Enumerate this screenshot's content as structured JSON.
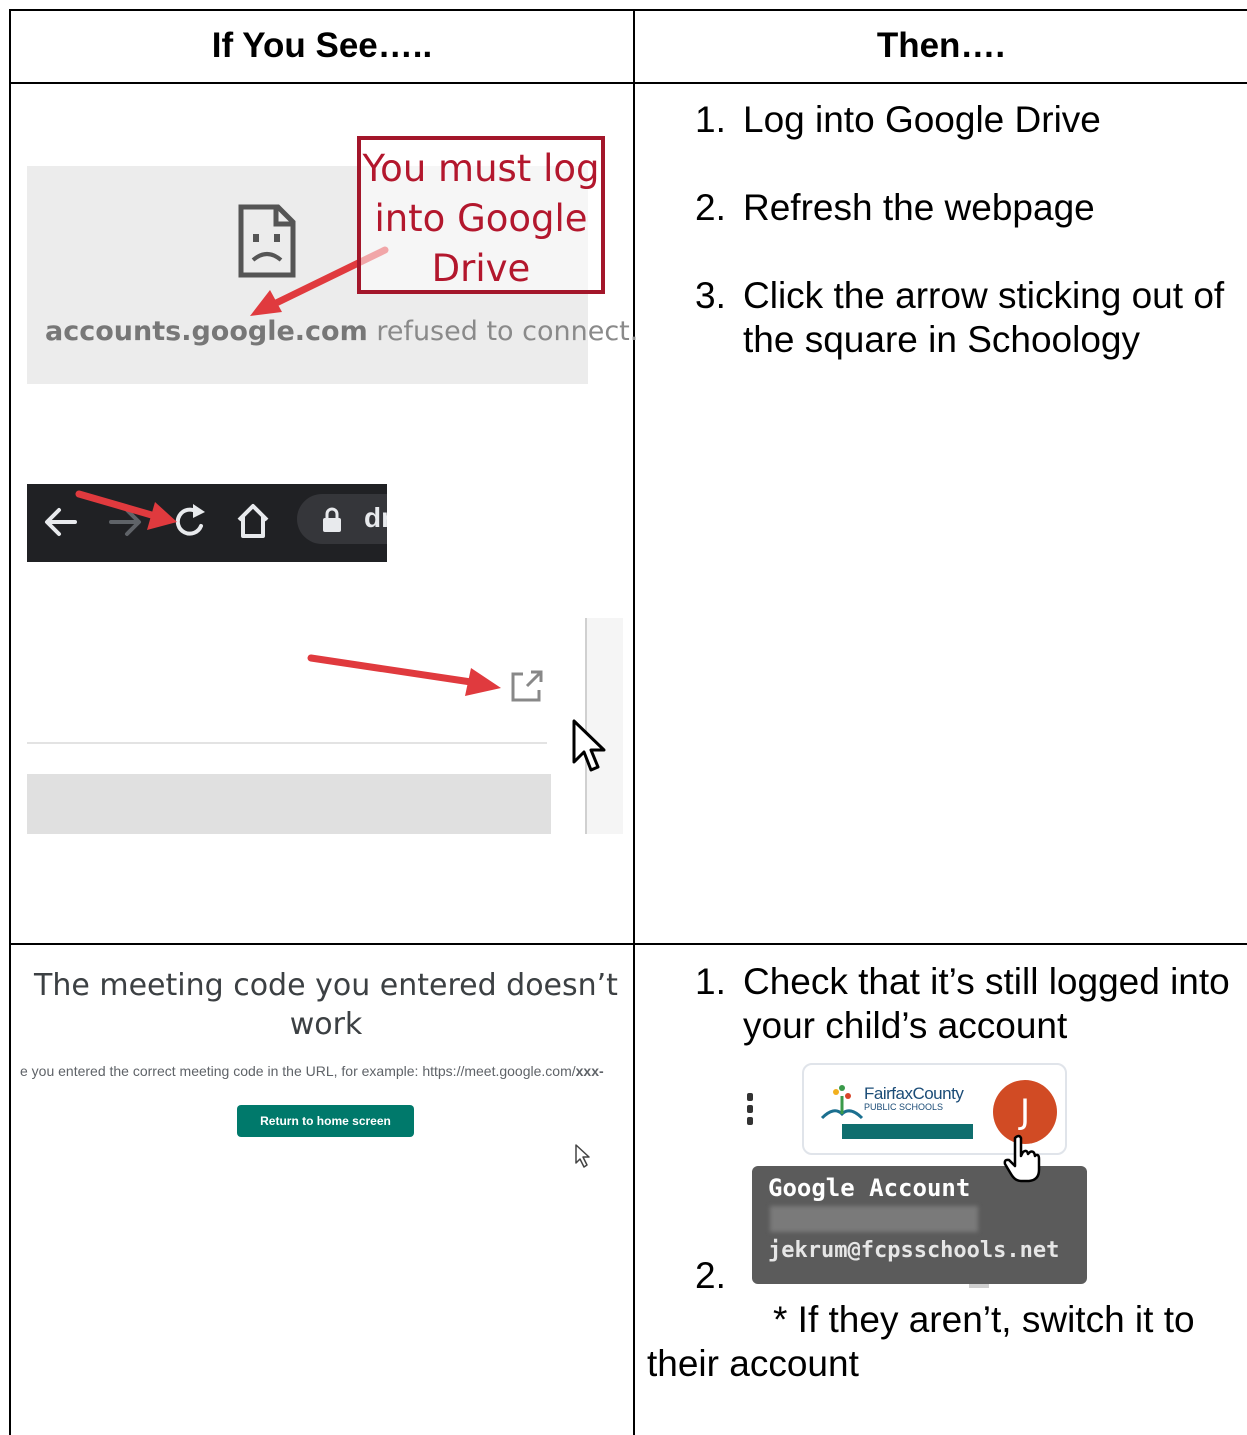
{
  "table": {
    "header_left": "If You See…..",
    "header_right": "Then…."
  },
  "row1": {
    "steps": [
      {
        "num": "1.",
        "text": "Log into Google Drive"
      },
      {
        "num": "2.",
        "text": "Refresh the webpage"
      },
      {
        "num": "3.",
        "text": "Click the arrow sticking out of the square in Schoology"
      }
    ],
    "refused": {
      "domain": "accounts.google.com",
      "rest": " refused to connect.",
      "callout": "You must log into Google Drive"
    },
    "toolbar": {
      "url_fragment": "dr"
    }
  },
  "row2": {
    "steps": [
      {
        "num": "1.",
        "text": "Check that it’s still logged into your child’s account"
      }
    ],
    "step2_num": "2.",
    "note": "* If they aren’t, switch it to their account",
    "meet": {
      "title": "The meeting code you entered doesn’t work",
      "subtitle_prefix": "e you entered the correct meeting code in the URL, for example: https://meet.google.com/",
      "subtitle_code": "xxx-",
      "button": "Return to home screen"
    },
    "account": {
      "logo_name": "FairfaxCounty",
      "logo_sub": "PUBLIC SCHOOLS",
      "avatar_letter": "J",
      "tooltip_title": "Google Account",
      "tooltip_email": "jekrum@fcpsschools.net"
    }
  },
  "colors": {
    "callout_red": "#a3162a",
    "arrow_red": "#e03a3e",
    "meet_button": "#00796b",
    "avatar": "#d14b24",
    "toolbar_bg": "#202124"
  },
  "icons": [
    "sad-document-icon",
    "back-arrow-icon",
    "forward-arrow-icon",
    "reload-icon",
    "home-icon",
    "lock-icon",
    "external-link-icon",
    "mouse-pointer-icon",
    "hand-pointer-icon",
    "kebab-menu-icon"
  ]
}
